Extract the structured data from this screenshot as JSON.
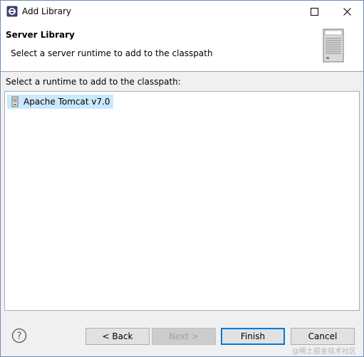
{
  "window": {
    "title": "Add Library"
  },
  "banner": {
    "title": "Server Library",
    "description": "Select a server runtime to add to the classpath",
    "icon": "server-icon"
  },
  "content": {
    "label": "Select a runtime to add to the classpath:",
    "runtimes": [
      {
        "label": "Apache Tomcat v7.0",
        "selected": true,
        "icon": "tomcat-runtime-icon"
      }
    ]
  },
  "buttons": {
    "back": "< Back",
    "next": "Next >",
    "finish": "Finish",
    "cancel": "Cancel"
  },
  "watermark": "@稀土掘金技术社区",
  "colors": {
    "accent": "#0078d7",
    "selection": "#cce8ff",
    "window_border": "#6f8fb8"
  }
}
